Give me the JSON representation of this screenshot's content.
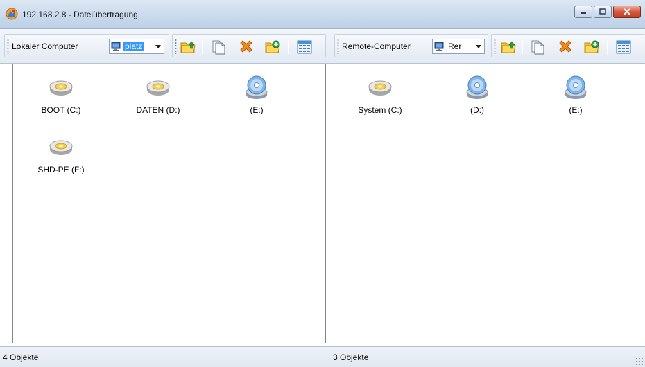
{
  "window": {
    "title": "192.168.2.8 - Dateiübertragung",
    "controls": [
      "minimize",
      "maximize",
      "close"
    ]
  },
  "left_pane": {
    "toolbar": {
      "label": "Lokaler Computer",
      "combo_value": "platz",
      "tools": [
        "folder-up-icon",
        "copy-icon",
        "delete-icon",
        "new-folder-icon",
        "view-icon"
      ]
    },
    "drives": [
      {
        "label": "BOOT (C:)",
        "type": "hard-disk"
      },
      {
        "label": "DATEN (D:)",
        "type": "hard-disk"
      },
      {
        "label": "(E:)",
        "type": "cd-drive"
      },
      {
        "label": "SHD-PE (F:)",
        "type": "hard-disk"
      }
    ],
    "status": "4 Objekte"
  },
  "right_pane": {
    "toolbar": {
      "label": "Remote-Computer",
      "combo_value": "Rer",
      "tools": [
        "folder-up-icon",
        "copy-icon",
        "delete-icon",
        "new-folder-icon",
        "view-icon"
      ]
    },
    "drives": [
      {
        "label": "System (C:)",
        "type": "hard-disk"
      },
      {
        "label": "(D:)",
        "type": "cd-drive"
      },
      {
        "label": "(E:)",
        "type": "cd-drive"
      }
    ],
    "status": "3 Objekte"
  },
  "colors": {
    "selection": "#3399ff",
    "close_button": "#c43d22",
    "folder_yellow": "#f5c531",
    "delete_orange": "#f08a1c"
  }
}
